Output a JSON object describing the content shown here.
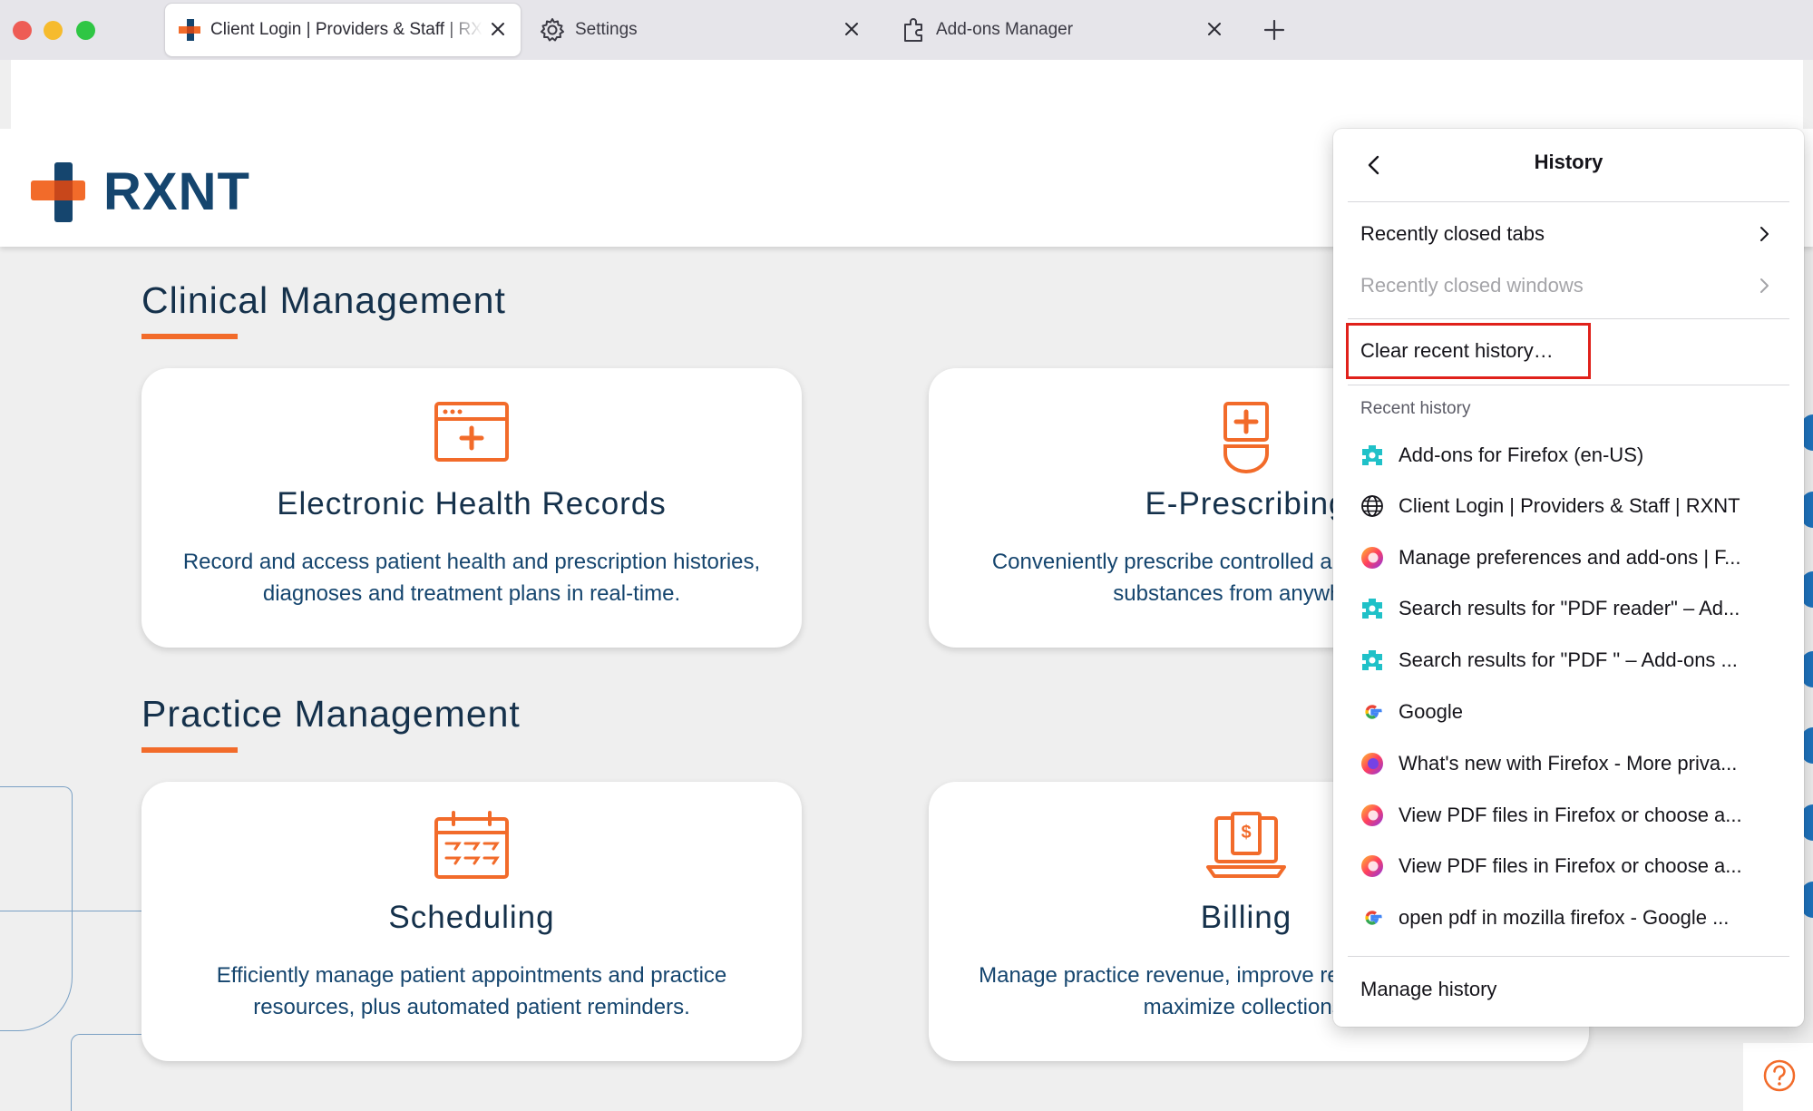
{
  "tabs": [
    {
      "label": "Client Login | Providers & Staff | RXNT",
      "active": true,
      "icon": "rxnt-cross-icon"
    },
    {
      "label": "Settings",
      "active": false,
      "icon": "gear-icon"
    },
    {
      "label": "Add-ons Manager",
      "active": false,
      "icon": "puzzle-icon"
    }
  ],
  "site": {
    "logo_text": "RXNT",
    "sections": [
      {
        "title": "Clinical Management",
        "cards": [
          {
            "title": "Electronic Health Records",
            "description": "Record and access patient health and prescription histories, diagnoses and treatment plans in real-time.",
            "icon": "ehr-icon"
          },
          {
            "title": "E-Prescribing",
            "description": "Conveniently prescribe controlled and non-controlled substances from anywhere.",
            "icon": "prescription-icon"
          }
        ]
      },
      {
        "title": "Practice Management",
        "cards": [
          {
            "title": "Scheduling",
            "description": "Efficiently manage patient appointments and practice resources, plus automated patient reminders.",
            "icon": "calendar-icon"
          },
          {
            "title": "Billing",
            "description": "Manage practice revenue, improve reimbursement, and maximize collections.",
            "icon": "billing-icon"
          }
        ]
      }
    ]
  },
  "history_panel": {
    "title": "History",
    "recently_closed_tabs": "Recently closed tabs",
    "recently_closed_windows": "Recently closed windows",
    "clear_recent_history": "Clear recent history…",
    "recent_history_heading": "Recent history",
    "items": [
      {
        "label": "Add-ons for Firefox (en-US)",
        "icon": "addons-puzzle-icon"
      },
      {
        "label": "Client Login | Providers & Staff | RXNT",
        "icon": "globe-icon"
      },
      {
        "label": "Manage preferences and add-ons | F...",
        "icon": "firefox-icon"
      },
      {
        "label": "Search results for \"PDF reader\" – Ad...",
        "icon": "addons-puzzle-icon"
      },
      {
        "label": "Search results for \"PDF \" – Add-ons ...",
        "icon": "addons-puzzle-icon"
      },
      {
        "label": "Google",
        "icon": "google-icon"
      },
      {
        "label": "What's new with Firefox - More priva...",
        "icon": "firefox-icon"
      },
      {
        "label": "View PDF files in Firefox or choose a...",
        "icon": "firefox-icon"
      },
      {
        "label": "View PDF files in Firefox or choose a...",
        "icon": "firefox-icon"
      },
      {
        "label": "open pdf in mozilla firefox - Google ...",
        "icon": "google-icon"
      }
    ],
    "manage_history": "Manage history"
  },
  "colors": {
    "brand_orange": "#f26b2a",
    "brand_navy": "#15456e",
    "highlight_red": "#e0211b"
  }
}
